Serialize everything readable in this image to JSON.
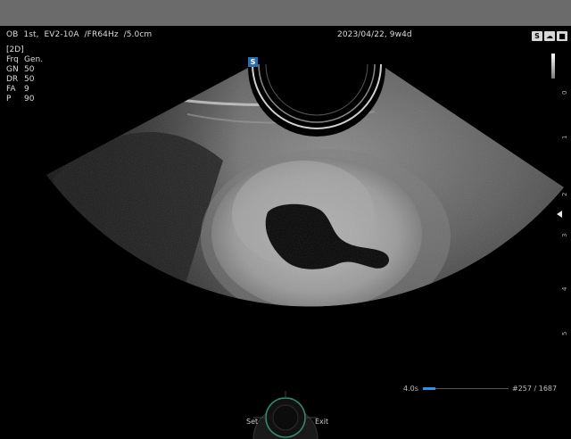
{
  "header": {
    "exam": "OB  1st,  EV2-10A  /FR64Hz  /5.0cm",
    "date_ga": "2023/04/22, 9w4d",
    "system_icons": [
      "S",
      "☁",
      "■"
    ]
  },
  "params": {
    "mode": "[2D]",
    "rows": [
      {
        "key": "Frq",
        "value": "Gen."
      },
      {
        "key": "GN",
        "value": "50"
      },
      {
        "key": "DR",
        "value": "50"
      },
      {
        "key": "FA",
        "value": "9"
      },
      {
        "key": "P",
        "value": "90"
      }
    ]
  },
  "probe_marker": "S",
  "depth_scale": {
    "labels": [
      "0",
      "1",
      "2",
      "3",
      "4",
      "5"
    ]
  },
  "cine": {
    "time": "4.0s",
    "frame": "#257 / 1687",
    "progress": 0.15
  },
  "softkeys": {
    "set": "Set",
    "exit": "Exit"
  },
  "colors": {
    "top_bar": "#6b6b6b",
    "accent": "#2b6fa8",
    "cine_fill": "#3b8de0"
  }
}
